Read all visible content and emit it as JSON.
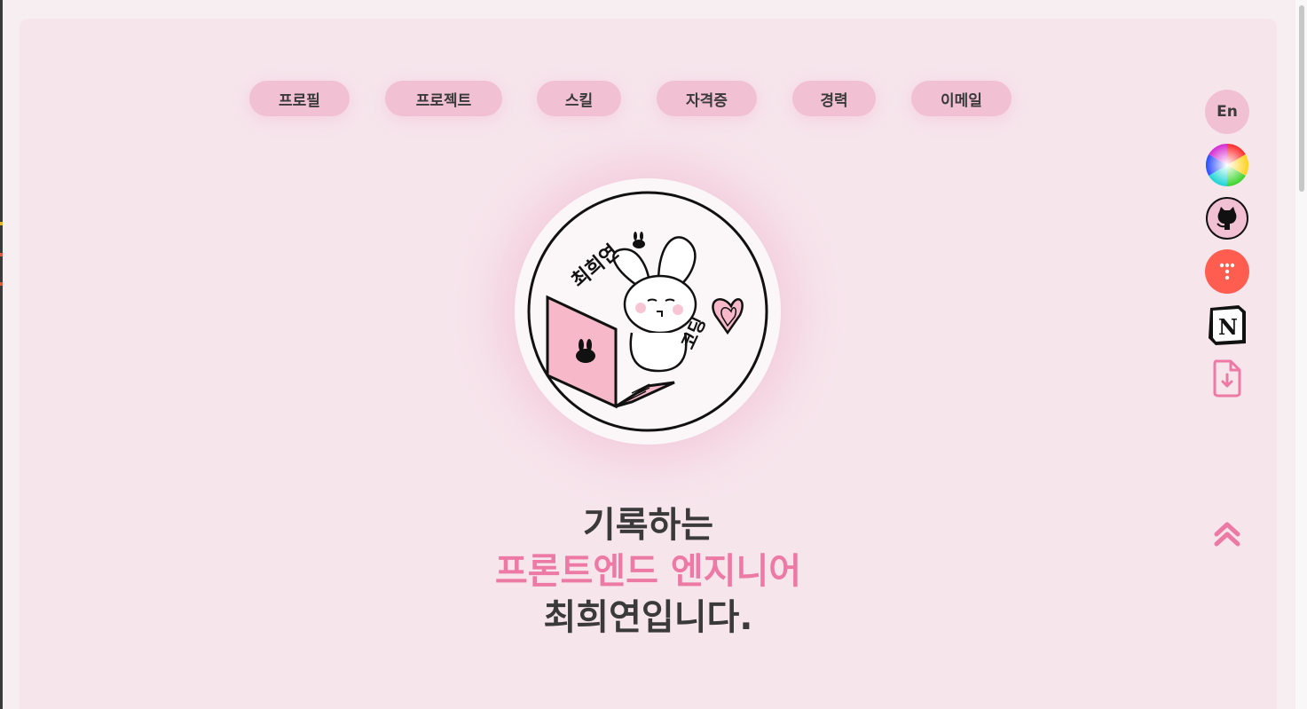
{
  "nav": {
    "items": [
      {
        "label": "프로필"
      },
      {
        "label": "프로젝트"
      },
      {
        "label": "스킬"
      },
      {
        "label": "자격증"
      },
      {
        "label": "경력"
      },
      {
        "label": "이메일"
      }
    ]
  },
  "hero": {
    "avatar_text_name": "최희연",
    "avatar_text_coding": "코딩",
    "line1": "기록하는",
    "line2": "프론트엔드 엔지니어",
    "line3": "최희연입니다."
  },
  "sidebar": {
    "lang_label": "En",
    "icons": [
      "color-wheel-icon",
      "github-icon",
      "dots-app-icon",
      "notion-icon",
      "file-download-icon"
    ],
    "scroll_top_icon": "double-chevron-up-icon"
  },
  "colors": {
    "background": "#f7e5ec",
    "nav_button": "#f1c0d2",
    "accent_pink": "#ec7aa4",
    "text_dark": "#3a3a3a",
    "coral": "#ff5d4f"
  }
}
